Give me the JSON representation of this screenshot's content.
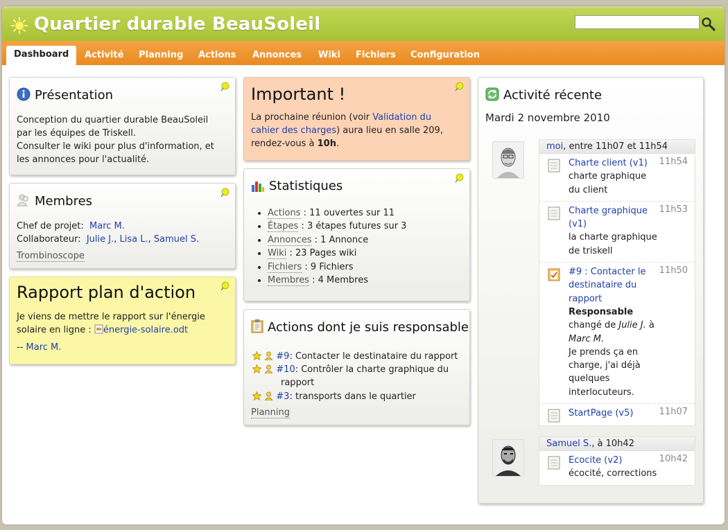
{
  "app": {
    "title": "Quartier durable BeauSoleil",
    "search_placeholder": ""
  },
  "tabs": [
    "Dashboard",
    "Activité",
    "Planning",
    "Actions",
    "Annonces",
    "Wiki",
    "Fichiers",
    "Configuration"
  ],
  "presentation": {
    "title": "Présentation",
    "line1": "Conception du quartier durable BeauSoleil",
    "line2": "par les équipes de Triskell.",
    "line3": "Consulter le wiki pour plus d'information, et",
    "line4": "les annonces pour l'actualité."
  },
  "membres": {
    "title": "Membres",
    "chef_label": "Chef de projet:",
    "chef": "Marc M.",
    "collab_label": "Collaborateur:",
    "collabs": [
      "Julie J.",
      "Lisa L.",
      "Samuel S."
    ],
    "trombi": "Trombinoscope"
  },
  "rapport": {
    "title": "Rapport plan d'action",
    "line1": "Je viens de mettre le rapport sur l'énergie",
    "line2": "solaire en ligne :",
    "file": "énergie-solaire.odt",
    "sig_prefix": "--",
    "sig": "Marc M."
  },
  "important": {
    "title": "Important !",
    "l1a": "La prochaine réunion (voir ",
    "l1link": "Validation du",
    "l2link": "cahier des charges",
    "l2b": ") aura lieu en salle 209,",
    "l3a": "rendez-vous à ",
    "l3b": "10h",
    "l3c": "."
  },
  "stats": {
    "title": "Statistiques",
    "items": [
      {
        "label": "Actions",
        "text": " : 11 ouvertes sur 11"
      },
      {
        "label": "Étapes",
        "text": " : 3 étapes futures sur 3"
      },
      {
        "label": "Annonces",
        "text": " : 1 Annonce"
      },
      {
        "label": "Wiki",
        "text": " : 23 Pages wiki"
      },
      {
        "label": "Fichiers",
        "text": " : 9 Fichiers"
      },
      {
        "label": "Membres",
        "text": " : 4 Membres"
      }
    ]
  },
  "actions_resp": {
    "title": "Actions dont je suis responsable",
    "items": [
      {
        "id": "#9",
        "text": ": Contacter le destinataire du rapport",
        "text2": ""
      },
      {
        "id": "#10",
        "text": ": Contrôler la charte graphique du",
        "text2": "rapport"
      },
      {
        "id": "#3",
        "text": ": transports dans le quartier",
        "text2": ""
      }
    ],
    "planning": "Planning"
  },
  "activite": {
    "title": "Activité récente",
    "date": "Mardi 2 novembre 2010",
    "feed1": {
      "user": "moi",
      "range": ", entre 11h07 et 11h54",
      "entries": [
        {
          "title": "Charte client (v1)",
          "desc": "charte graphique du client",
          "time": "11h54"
        },
        {
          "title": "Charte graphique (v1)",
          "desc": "la charte graphique de triskell",
          "time": "11h53"
        },
        {
          "title": "#9 : Contacter le destinataire du rapport",
          "resp": "Responsable",
          "chg_a": "changé de ",
          "from": "Julie J.",
          "chg_b": " à",
          "to": "Marc M.",
          "desc": "Je prends ça en charge, j'ai déjà quelques interlocuteurs.",
          "time": "11h50"
        },
        {
          "title": "StartPage (v5)",
          "desc": "",
          "time": "11h07"
        }
      ]
    },
    "feed2": {
      "user": "Samuel S.",
      "range": ", à 10h42",
      "entries": [
        {
          "title": "Ecocite (v2)",
          "desc": "écocité, corrections",
          "time": "10h42"
        }
      ]
    }
  },
  "colors": {
    "header_green": "#a8c236",
    "tabbar_orange": "#ea8a20",
    "link": "#1f3fa8",
    "important_bg": "#fdd3b6",
    "note_yellow": "#fbf7a7"
  },
  "icons": [
    "sun-logo-icon",
    "search-icon",
    "info-icon",
    "members-icon",
    "pin-icon",
    "chart-icon",
    "clipboard-icon",
    "refresh-icon",
    "document-icon",
    "task-icon",
    "star-icon",
    "person-icon",
    "file-icon",
    "avatar-photo"
  ]
}
